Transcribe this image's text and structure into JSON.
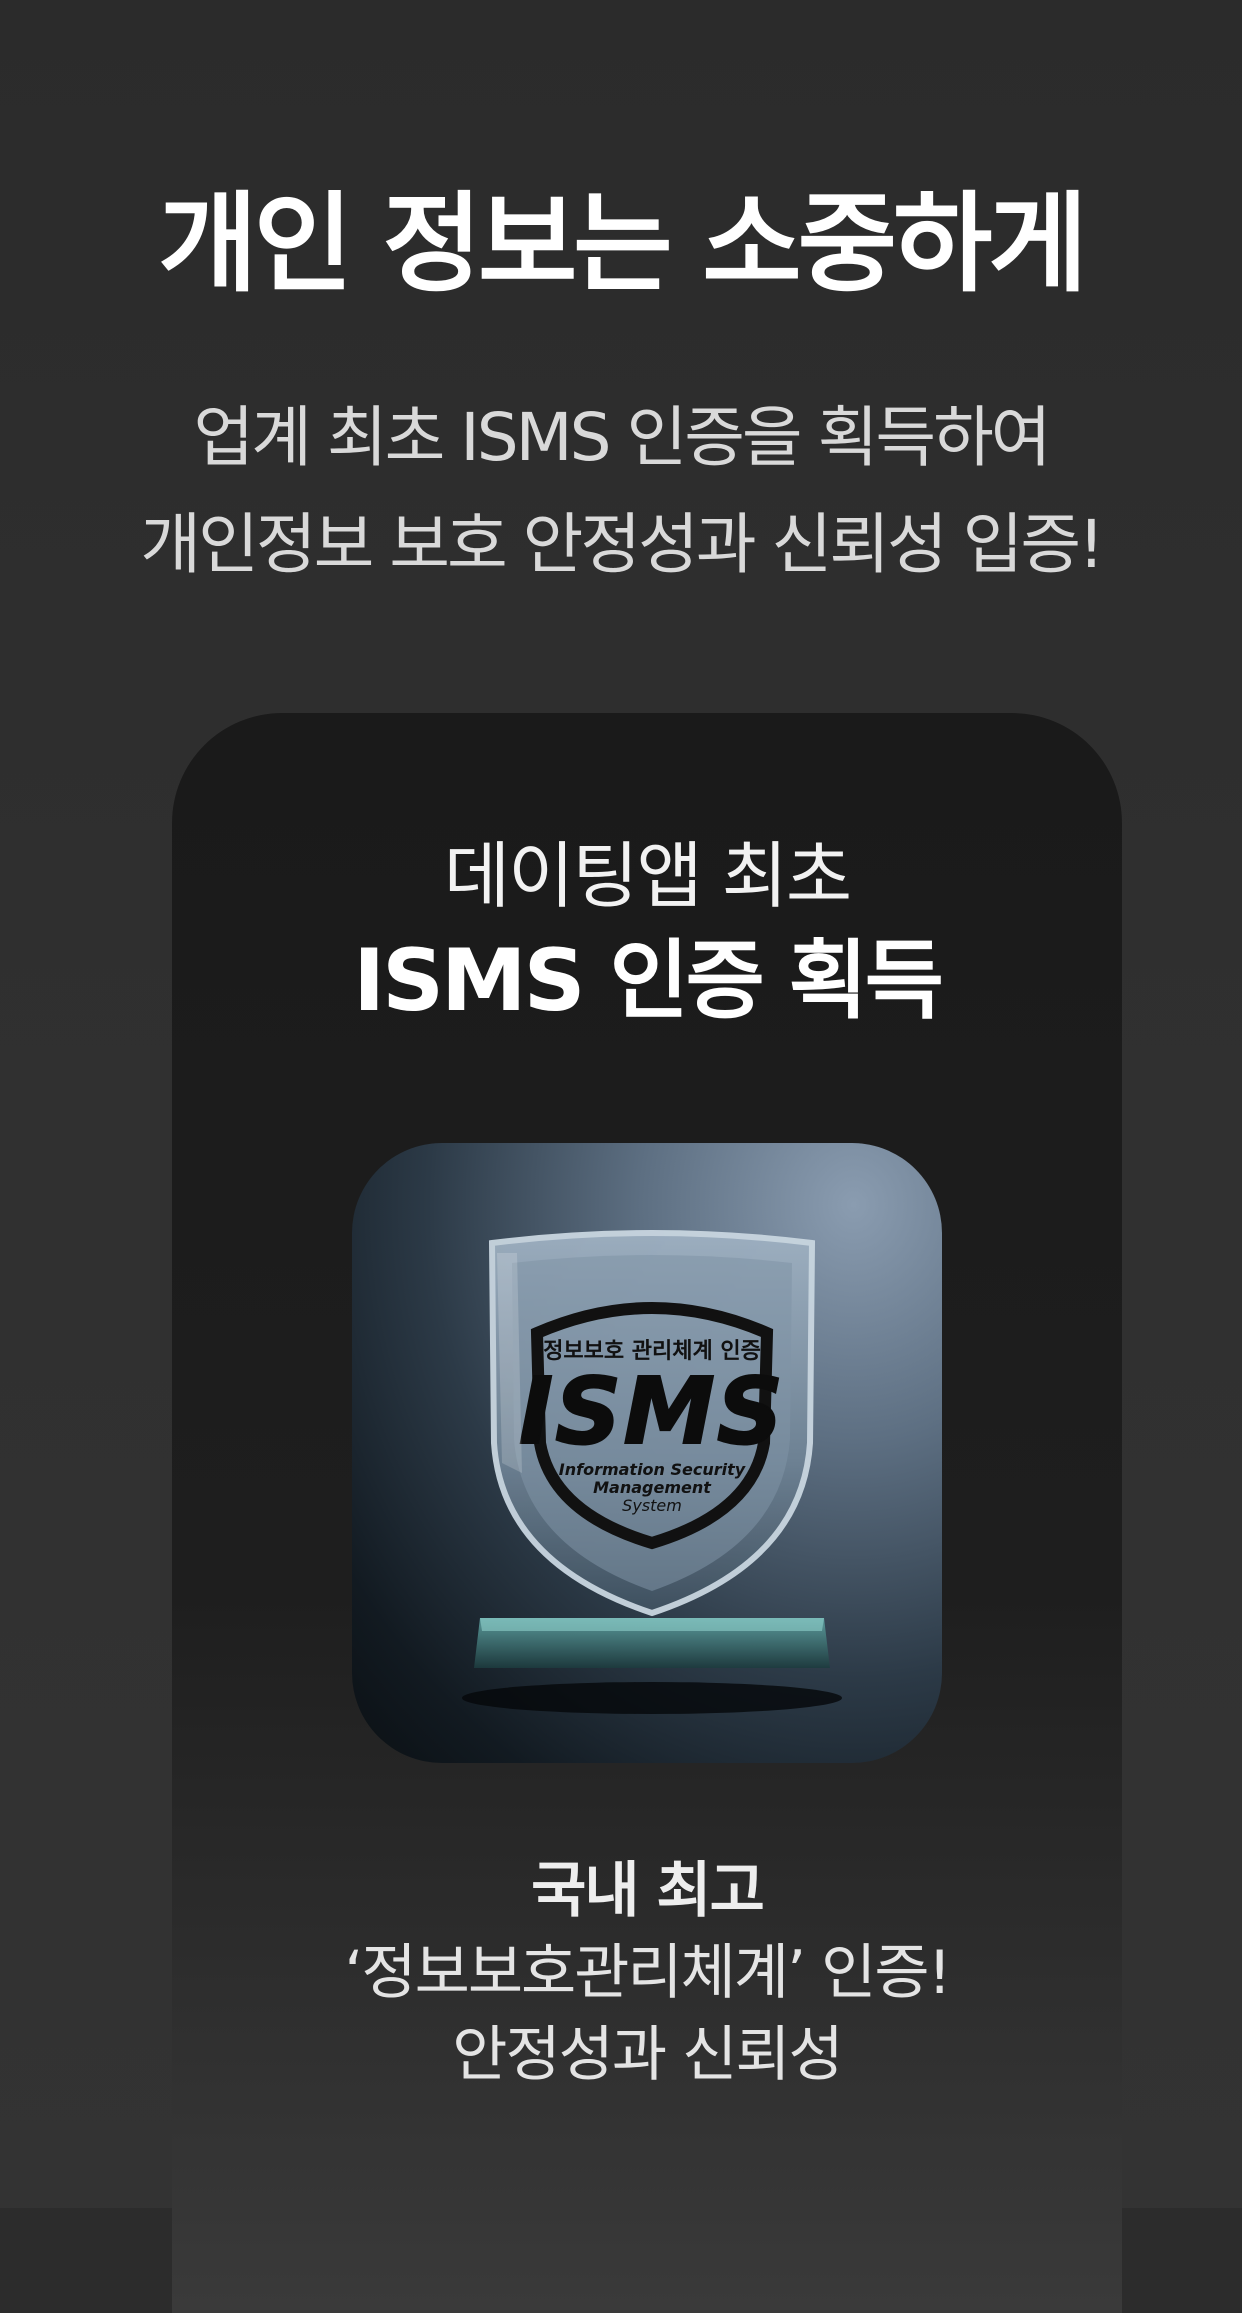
{
  "header": {
    "title": "개인 정보는 소중하게",
    "subtitle_line1": "업계 최초 ISMS 인증을 획득하여",
    "subtitle_line2": "개인정보 보호 안정성과 신뢰성 입증!"
  },
  "card": {
    "kicker": "데이팅앱 최초",
    "title": "ISMS 인증 획득",
    "badge": {
      "top_text": "정보보호 관리체계 인증",
      "logo_text": "ISMS",
      "bottom_line1": "Information Security",
      "bottom_line2": "Management",
      "bottom_line3": "System"
    },
    "footer_bold": "국내 최고",
    "footer_line1": "‘정보보호관리체계’ 인증!",
    "footer_line2": "안정성과 신뢰성"
  },
  "colors": {
    "background": "#2c2c2c",
    "card": "#1a1a1a",
    "text_primary": "#ffffff",
    "text_secondary": "#d9d9d9"
  }
}
